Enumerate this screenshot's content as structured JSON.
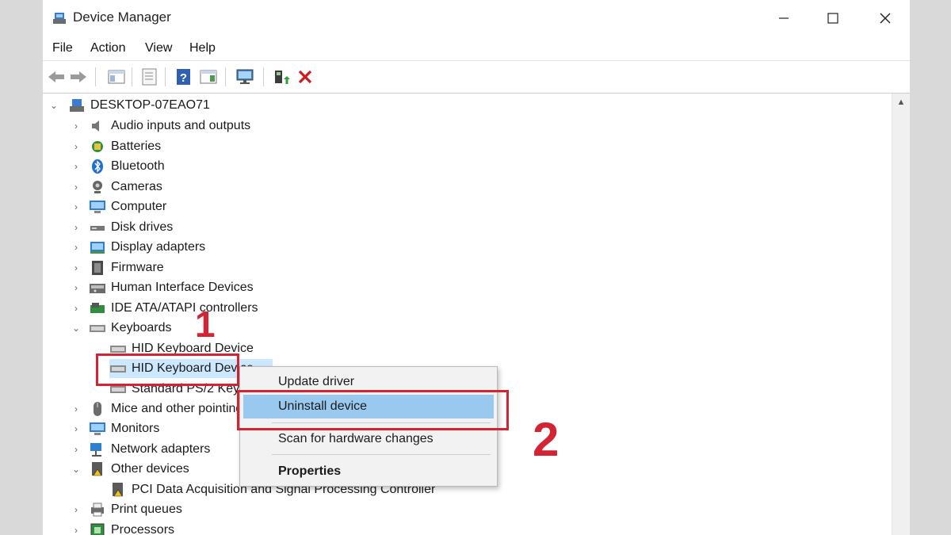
{
  "window": {
    "title": "Device Manager"
  },
  "menubar": {
    "items": [
      "File",
      "Action",
      "View",
      "Help"
    ]
  },
  "toolbar": {
    "buttons": [
      "back",
      "forward",
      "properties-pane",
      "details",
      "help",
      "view",
      "monitor",
      "scan-hardware",
      "uninstall"
    ]
  },
  "tree": {
    "root": "DESKTOP-07EAO71",
    "categories": [
      "Audio inputs and outputs",
      "Batteries",
      "Bluetooth",
      "Cameras",
      "Computer",
      "Disk drives",
      "Display adapters",
      "Firmware",
      "Human Interface Devices",
      "IDE ATA/ATAPI controllers",
      "Keyboards",
      "Mice and other pointing devices",
      "Monitors",
      "Network adapters",
      "Other devices",
      "Print queues",
      "Processors"
    ],
    "keyboards_children": [
      "HID Keyboard Device",
      "HID Keyboard Device",
      "Standard PS/2 Keyboard"
    ],
    "other_devices_children": [
      "PCI Data Acquisition and Signal Processing Controller"
    ]
  },
  "context_menu": {
    "items": [
      "Update driver",
      "Uninstall device",
      "Scan for hardware changes",
      "Properties"
    ],
    "highlighted": "Uninstall device"
  },
  "annotations": {
    "step1": "1",
    "step2": "2"
  },
  "colors": {
    "highlight_red": "#d32433",
    "menu_selection": "#99c9ef",
    "tree_selection": "#cce8ff"
  }
}
